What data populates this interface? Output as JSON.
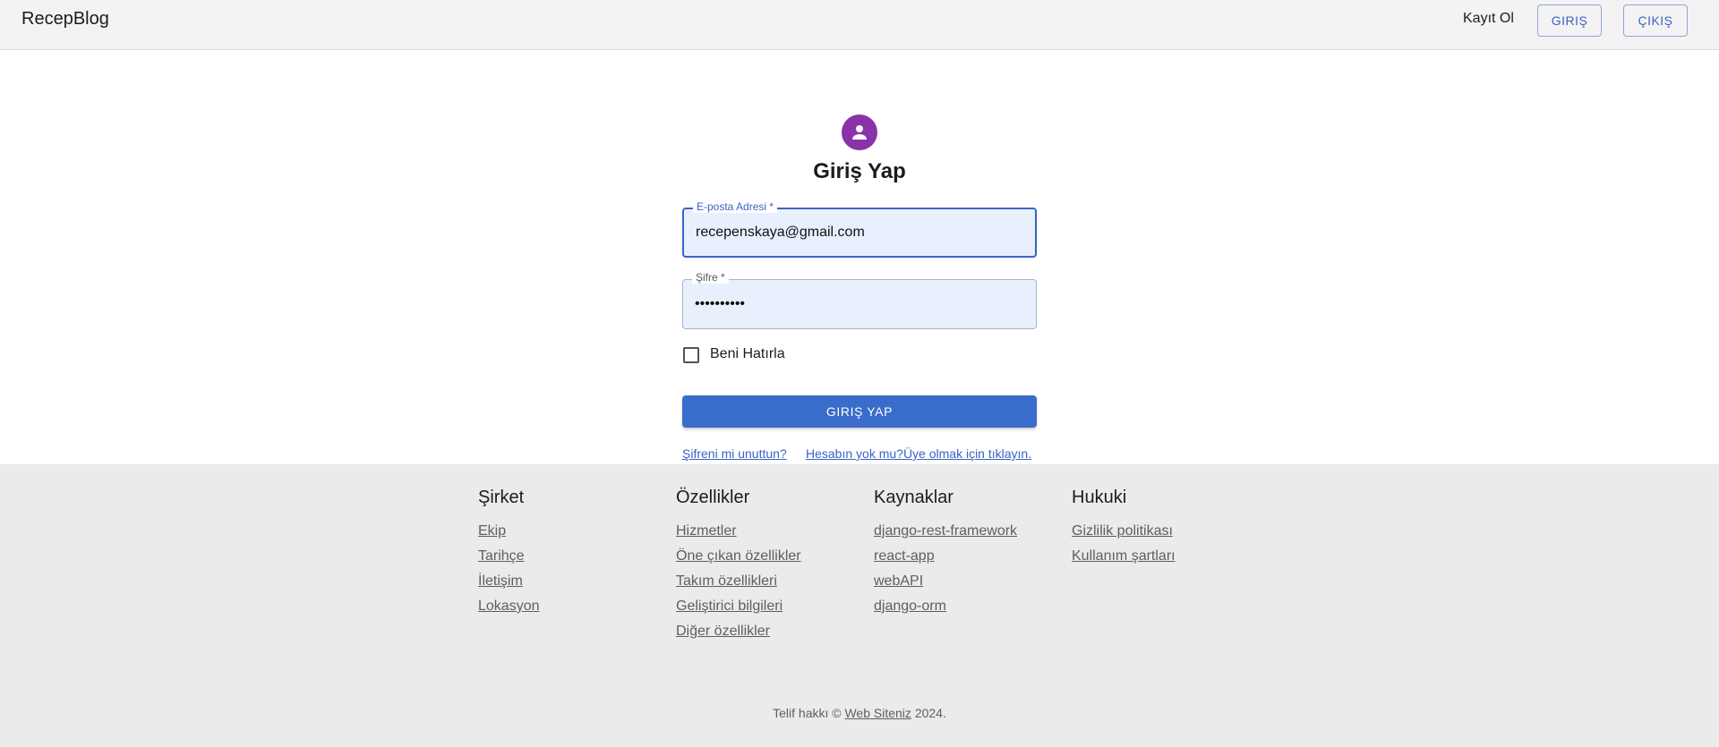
{
  "header": {
    "brand": "RecepBlog",
    "register_link": "Kayıt Ol",
    "login_button": "GIRIŞ",
    "logout_button": "ÇIKIŞ"
  },
  "login_form": {
    "title": "Giriş Yap",
    "email_label": "E-posta Adresi *",
    "email_value": "recepenskaya@gmail.com",
    "password_label": "Şifre *",
    "password_value": "••••••••••",
    "remember_label": "Beni Hatırla",
    "submit_label": "GIRIŞ YAP",
    "forgot_link": "Şifreni mi unuttun?",
    "signup_link": "Hesabın yok mu?Üye olmak için tıklayın."
  },
  "footer": {
    "columns": [
      {
        "title": "Şirket",
        "links": [
          "Ekip",
          "Tarihçe",
          "İletişim",
          "Lokasyon"
        ]
      },
      {
        "title": "Özellikler",
        "links": [
          "Hizmetler",
          "Öne çıkan özellikler",
          "Takım özellikleri",
          "Geliştirici bilgileri",
          "Diğer özellikler"
        ]
      },
      {
        "title": "Kaynaklar",
        "links": [
          "django-rest-framework",
          "react-app",
          "webAPI",
          "django-orm"
        ]
      },
      {
        "title": "Hukuki",
        "links": [
          "Gizlilik politikası",
          "Kullanım şartları"
        ]
      }
    ],
    "copyright_prefix": "Telif hakkı ©",
    "copyright_link": "Web Siteniz",
    "copyright_suffix": "2024."
  },
  "colors": {
    "primary": "#3a6ccb",
    "avatar": "#8a32a8",
    "footer_bg": "#ebebeb",
    "header_bg": "#f3f3f3"
  },
  "icons": {
    "avatar": "person-icon"
  }
}
